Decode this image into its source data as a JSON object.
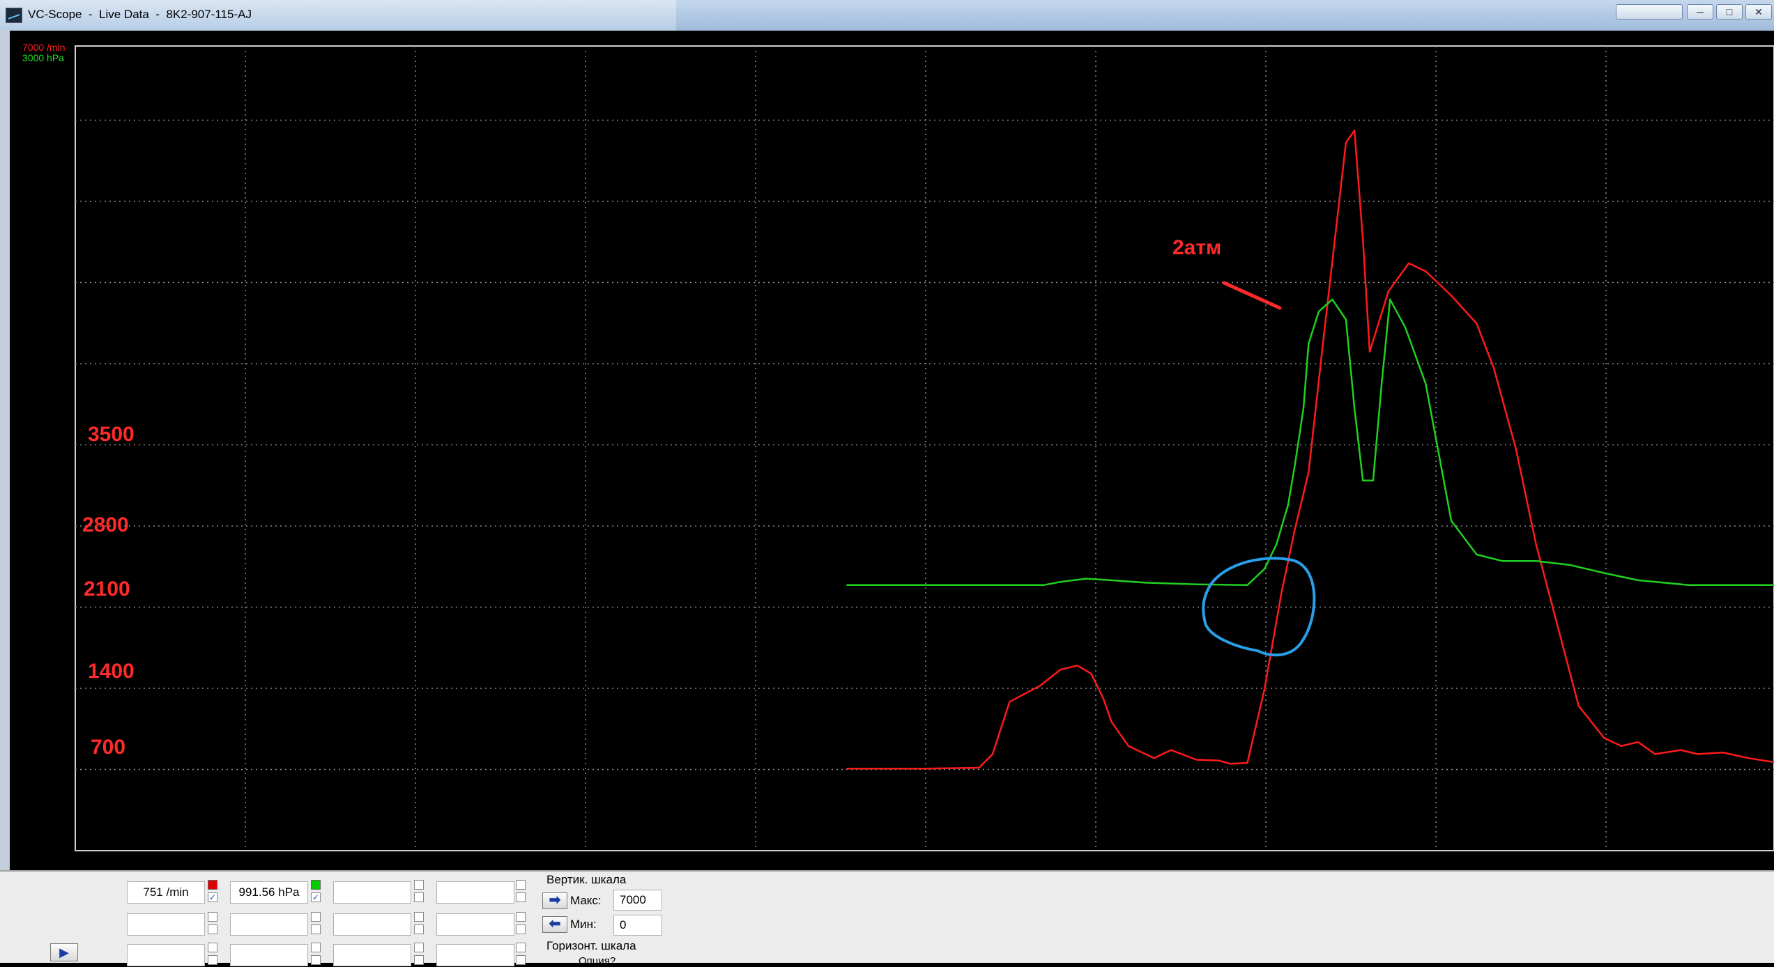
{
  "window": {
    "title": "VC-Scope  -  Live Data  -  8K2-907-115-AJ",
    "controls": [
      "─",
      "□",
      "✕"
    ]
  },
  "chart_data": {
    "type": "line",
    "x_range": [
      0,
      100
    ],
    "y_range": [
      0,
      100
    ],
    "grid": true,
    "scale_labels": {
      "rpm": "7000 /min",
      "pressure": "3000 hPa"
    },
    "series": [
      {
        "color": "#ff1a1a",
        "x": [
          45.4,
          50.0,
          53.2,
          54.0,
          55.0,
          56.8,
          58.0,
          59.0,
          59.8,
          60.5,
          61.0,
          62.0,
          63.5,
          64.5,
          66.0,
          67.3,
          68.0,
          69.0,
          70.0,
          71.0,
          71.8,
          72.6,
          73.5,
          74.8,
          75.3,
          75.8,
          76.2,
          77.3,
          78.5,
          79.5,
          81.0,
          82.5,
          83.5,
          84.8,
          86.0,
          87.0,
          88.5,
          90.0,
          91.0,
          92.0,
          93.0,
          94.5,
          95.5,
          97.0,
          98.5,
          100.0
        ],
        "y": [
          10.2,
          10.2,
          10.3,
          12.0,
          18.5,
          20.5,
          22.5,
          23.0,
          22.0,
          19.0,
          16.0,
          13.0,
          11.5,
          12.5,
          11.3,
          11.2,
          10.8,
          10.9,
          20.0,
          32.0,
          40.0,
          47.0,
          64.0,
          88.0,
          89.5,
          76.0,
          62.0,
          69.5,
          73.0,
          72.0,
          69.0,
          65.5,
          60.0,
          50.0,
          38.0,
          30.0,
          18.0,
          14.0,
          13.0,
          13.5,
          12.0,
          12.5,
          12.0,
          12.2,
          11.5,
          11.0
        ]
      },
      {
        "color": "#20d020",
        "x": [
          45.4,
          57.0,
          58.0,
          59.5,
          61.0,
          63.0,
          66.0,
          69.0,
          70.0,
          70.7,
          71.4,
          71.8,
          72.3,
          72.6,
          73.2,
          74.0,
          74.8,
          75.3,
          75.8,
          76.4,
          76.9,
          77.4,
          78.3,
          79.5,
          81.0,
          82.5,
          84.0,
          86.0,
          88.0,
          90.0,
          92.0,
          95.0,
          100.0
        ],
        "y": [
          33.0,
          33.0,
          33.4,
          33.8,
          33.6,
          33.3,
          33.1,
          33.0,
          35.0,
          38.0,
          43.0,
          48.0,
          55.0,
          63.0,
          67.0,
          68.5,
          66.0,
          55.0,
          46.0,
          46.0,
          58.0,
          68.5,
          65.0,
          58.0,
          41.0,
          36.8,
          36.0,
          36.0,
          35.5,
          34.5,
          33.6,
          33.0,
          33.0
        ]
      }
    ]
  },
  "axis_annotations": [
    "3500",
    "2800",
    "2100",
    "1400",
    "700"
  ],
  "callout": "2атм",
  "panel": {
    "rpm_value": "751 /min",
    "hpa_value": "991.56 hPa",
    "vertical_scale_label": "Вертик. шкала",
    "max_label": "Макс:",
    "max_value": "7000",
    "min_label": "Мин:",
    "min_value": "0",
    "horizontal_scale_label": "Горизонт. шкала",
    "horizontal_value": "Опция?",
    "check_mark": "✓",
    "swatch_red": "#e00000",
    "swatch_green": "#00cc00",
    "arrow_max": "➡",
    "arrow_min": "⬅",
    "play": "▶"
  }
}
